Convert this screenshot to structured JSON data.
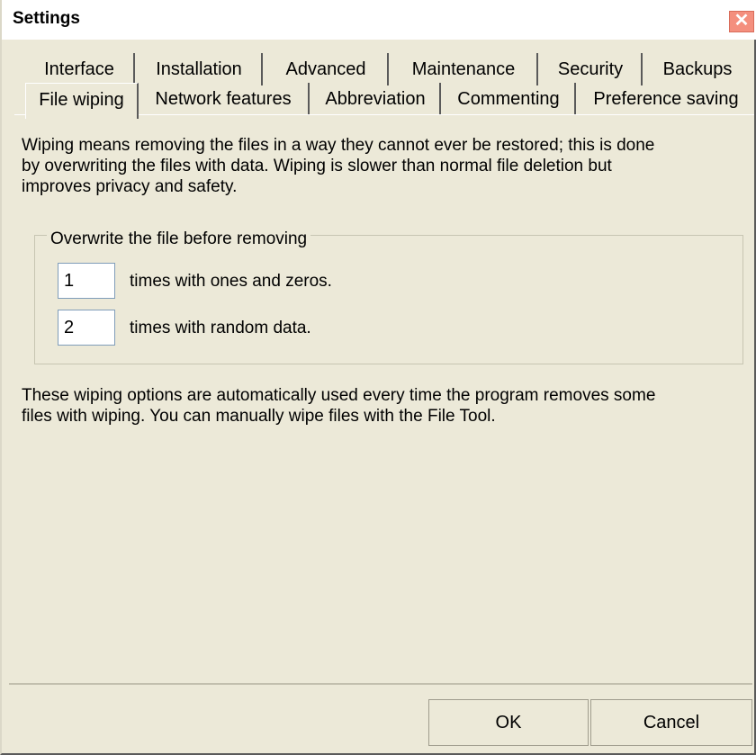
{
  "window": {
    "title": "Settings",
    "close_glyph": "✕"
  },
  "tabs_row1": [
    "Interface",
    "Installation",
    "Advanced",
    "Maintenance",
    "Security",
    "Backups"
  ],
  "tabs_row2": [
    "File wiping",
    "Network features",
    "Abbreviation",
    "Commenting",
    "Preference saving"
  ],
  "active_tab": "File wiping",
  "content": {
    "intro_lines": [
      "Wiping means removing the files in a way they cannot ever be restored; this is done",
      "by overwriting the files with data. Wiping is slower than normal file deletion but",
      "improves privacy and safety."
    ],
    "group_title": "Overwrite the file before removing",
    "ones_zeros": {
      "value": "1",
      "label": "times with ones and zeros."
    },
    "random": {
      "value": "2",
      "label": "times with random data."
    },
    "footer_lines": [
      "These wiping options are automatically used every time the program removes some",
      "files with wiping. You can manually wipe files with the File Tool."
    ]
  },
  "buttons": {
    "ok": "OK",
    "cancel": "Cancel"
  },
  "colors": {
    "dialog_bg": "#ece9d8",
    "close_btn": "#f48f7e"
  }
}
